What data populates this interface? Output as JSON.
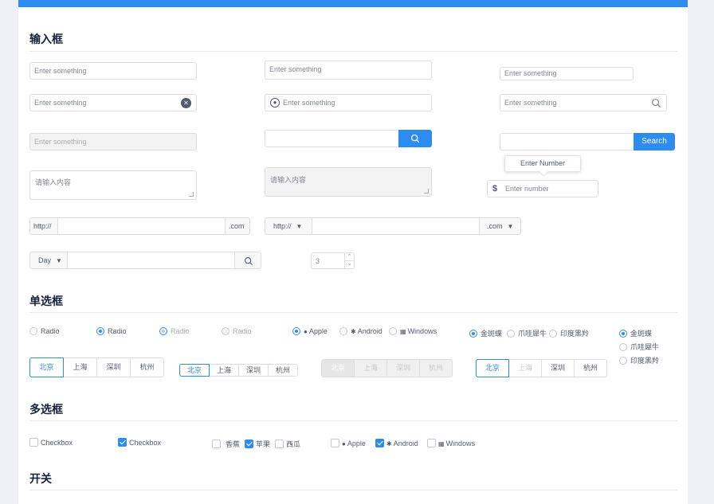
{
  "sections": {
    "input": "输入框",
    "radio": "单选框",
    "checkbox": "多选框",
    "switch": "开关"
  },
  "inputs": {
    "placeholder": "Enter something",
    "textarea_placeholder": "请输入内容",
    "search_label": "Search",
    "number_tooltip": "Enter Number",
    "number_placeholder": "Enter number",
    "currency": "$",
    "prefix_http": "http://",
    "suffix_com": ".com",
    "select_http": "http://",
    "select_com": ".com",
    "select_day": "Day",
    "stepper_value": "3"
  },
  "radios": {
    "radio_label": "Radio",
    "apple": "Apple",
    "android": "Android",
    "windows": "Windows",
    "animals": [
      "金斑蝶",
      "爪哇犀牛",
      "印度黑羚"
    ],
    "cities": [
      "北京",
      "上海",
      "深圳",
      "杭州"
    ]
  },
  "checkboxes": {
    "checkbox_label": "Checkbox",
    "fruits": [
      "香蕉",
      "苹果",
      "西瓜"
    ],
    "apple": "Apple",
    "android": "Android",
    "windows": "Windows"
  },
  "colors": {
    "primary": "#2d8cf0",
    "border": "#dcdee2",
    "title": "#17233d"
  }
}
